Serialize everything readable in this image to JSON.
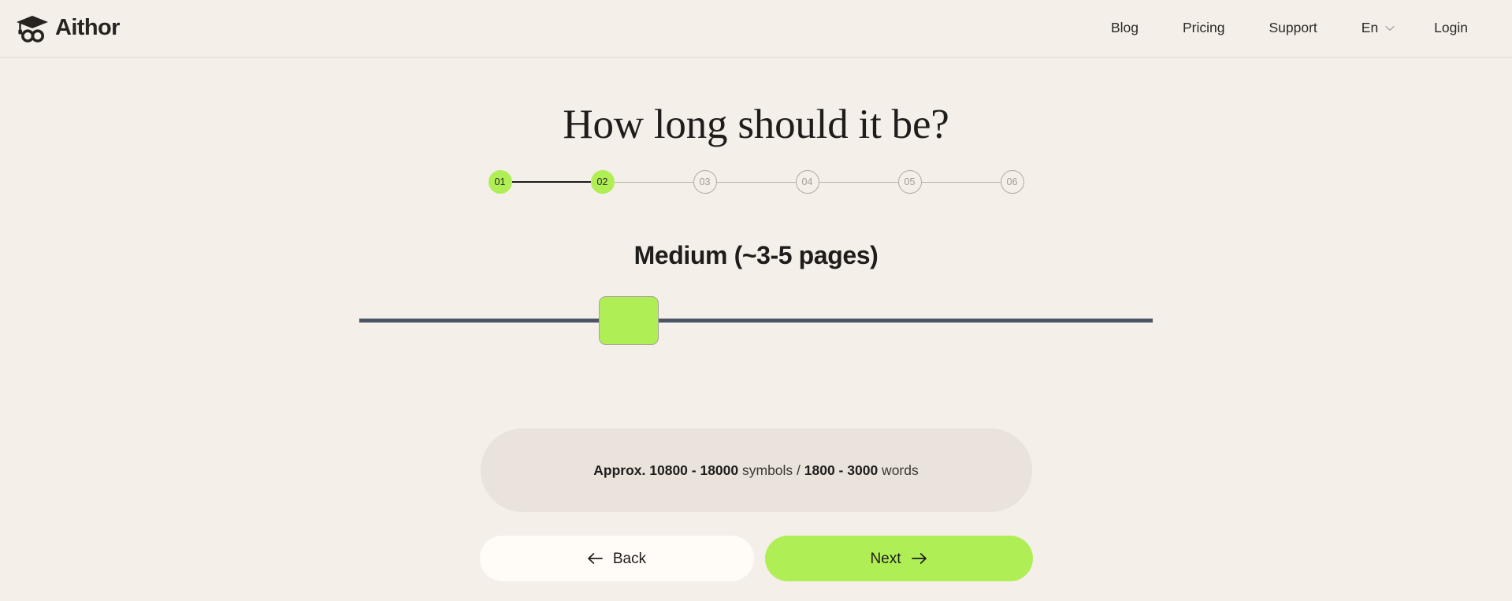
{
  "brand": {
    "name": "Aithor",
    "logo_icon": "graduation-cap-infinity-icon"
  },
  "nav": {
    "items": [
      {
        "label": "Blog"
      },
      {
        "label": "Pricing"
      },
      {
        "label": "Support"
      }
    ],
    "language": {
      "label": "En",
      "icon": "chevron-down-icon"
    },
    "login": {
      "label": "Login"
    }
  },
  "main": {
    "title": "How long should it be?",
    "stepper": {
      "steps": [
        {
          "label": "01",
          "state": "done"
        },
        {
          "label": "02",
          "state": "done"
        },
        {
          "label": "03",
          "state": "todo"
        },
        {
          "label": "04",
          "state": "todo"
        },
        {
          "label": "05",
          "state": "todo"
        },
        {
          "label": "06",
          "state": "todo"
        }
      ]
    },
    "slider": {
      "value_label": "Medium (~3-5 pages)",
      "position_percent": 34
    },
    "info": {
      "prefix_bold": "Approx. 10800 - 18000",
      "middle": " symbols / ",
      "suffix_bold": "1800 - 3000",
      "tail": " words"
    },
    "buttons": {
      "back": {
        "label": "Back",
        "icon": "arrow-left-icon"
      },
      "next": {
        "label": "Next",
        "icon": "arrow-right-icon"
      }
    }
  },
  "colors": {
    "accent_green": "#B0EE55",
    "background": "#F4EFE9",
    "info_box": "#E9E3DC",
    "track": "#4D5465",
    "text": "#1F1D1B"
  }
}
